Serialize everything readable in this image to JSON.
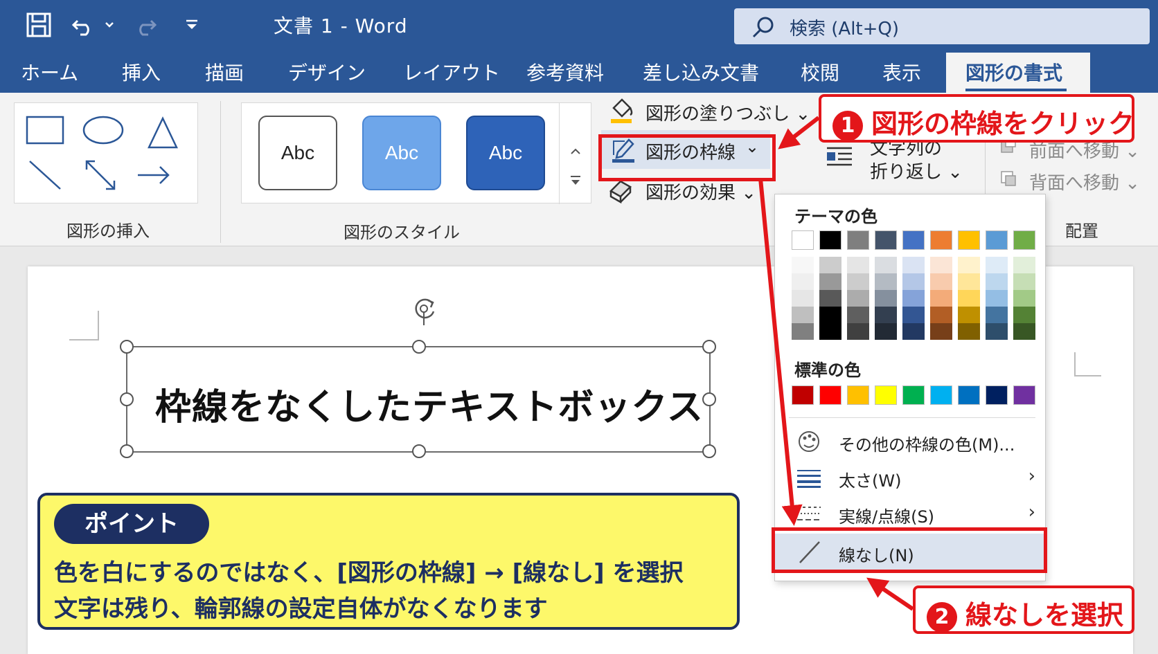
{
  "titlebar": {
    "title": "文書 1 - Word",
    "search_placeholder": "検索 (Alt+Q)"
  },
  "tabs": [
    "ホーム",
    "挿入",
    "描画",
    "デザイン",
    "レイアウト",
    "参考資料",
    "差し込み文書",
    "校閲",
    "表示"
  ],
  "active_tab": "図形の書式",
  "ribbon": {
    "insert_group_label": "図形の挿入",
    "styles_group_label": "図形のスタイル",
    "style_samples": [
      "Abc",
      "Abc",
      "Abc"
    ],
    "fill_label": "図形の塗りつぶし",
    "outline_label": "図形の枠線",
    "effects_label": "図形の効果",
    "wrap_label_1": "文字列の",
    "wrap_label_2": "折り返し",
    "bring_forward": "前面へ移動",
    "send_backward": "背面へ移動",
    "arrange_label": "配置"
  },
  "document": {
    "textbox_text": "枠線をなくしたテキストボックス"
  },
  "point": {
    "badge": "ポイント",
    "line1": "色を白にするのではなく、[図形の枠線] → [線なし] を選択",
    "line2": "文字は残り、輪郭線の設定自体がなくなります"
  },
  "dropdown": {
    "theme_colors_label": "テーマの色",
    "standard_colors_label": "標準の色",
    "theme_colors": [
      "#ffffff",
      "#000000",
      "#7f7f7f",
      "#44546a",
      "#4472c4",
      "#ed7d31",
      "#ffc000",
      "#5b9bd5",
      "#70ad47"
    ],
    "standard_colors": [
      "#c00000",
      "#ff0000",
      "#ffc000",
      "#ffff00",
      "#00b050",
      "#00b0f0",
      "#0070c0",
      "#002060",
      "#7030a0"
    ],
    "more_colors": "その他の枠線の色(M)...",
    "weight": "太さ(W)",
    "dashes": "実線/点線(S)",
    "no_outline": "線なし(N)"
  },
  "annotations": {
    "step1": "図形の枠線をクリック",
    "step1_num": "1",
    "step2": "線なしを選択",
    "step2_num": "2"
  },
  "colors": {
    "ribbon_blue": "#2b5797",
    "accent_red": "#e3161a",
    "point_bg": "#fdf86a",
    "point_border": "#1d2f62"
  }
}
